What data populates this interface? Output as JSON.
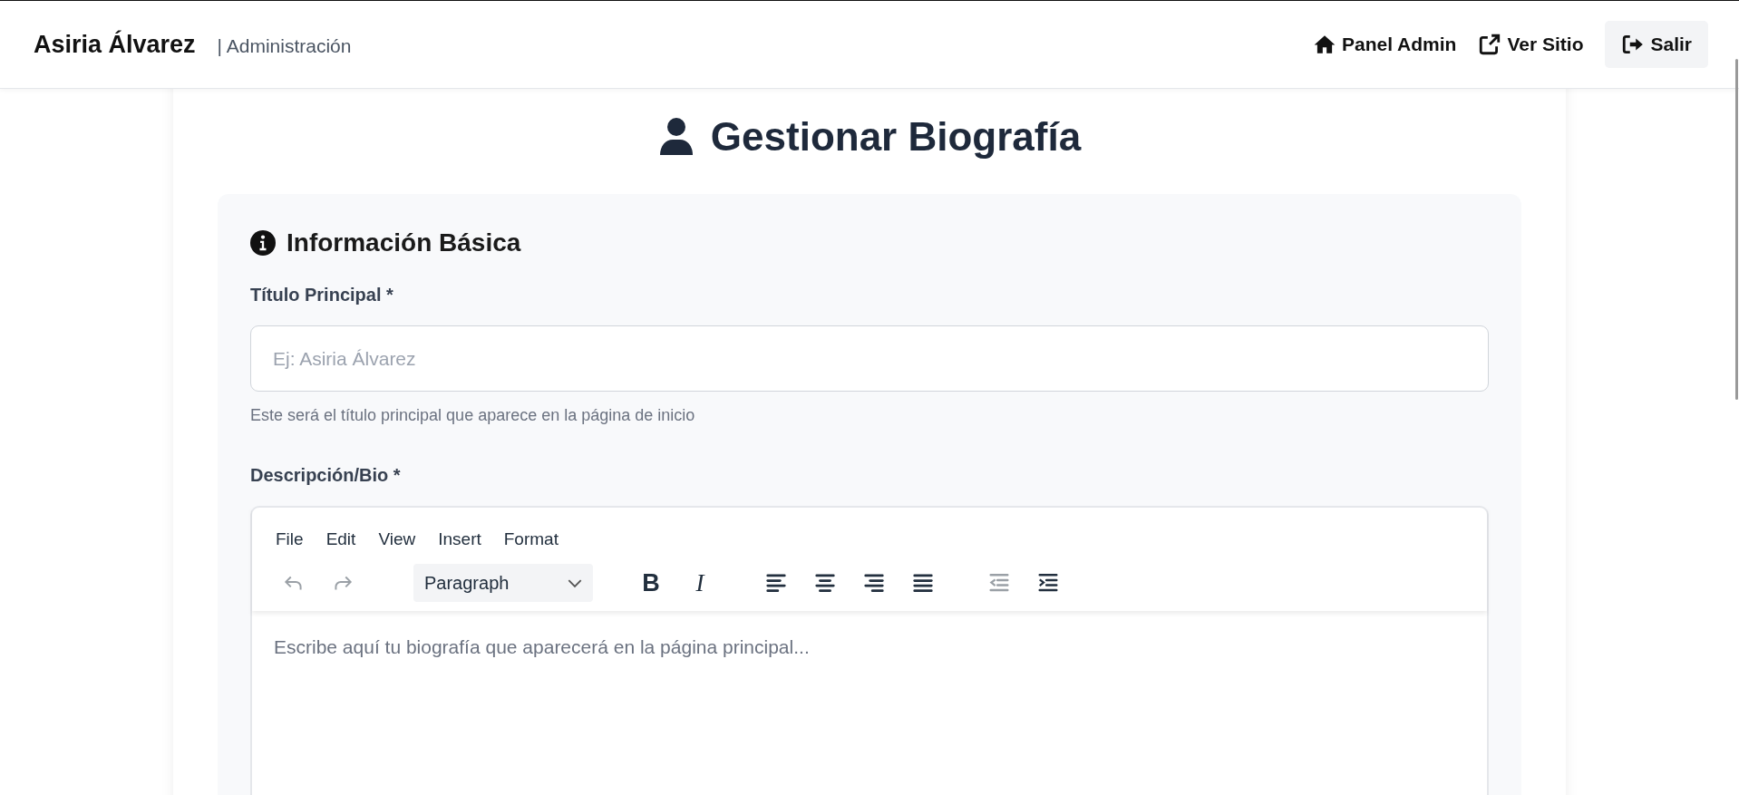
{
  "header": {
    "brand": "Asiria Álvarez",
    "subtitle": "| Administración",
    "nav": [
      {
        "kind": "home",
        "label": "Panel Admin"
      },
      {
        "kind": "external",
        "label": "Ver Sitio"
      },
      {
        "kind": "logout",
        "label": "Salir"
      }
    ]
  },
  "page_title": "Gestionar Biografía",
  "section": {
    "title": "Información Básica",
    "title_field": {
      "label": "Título Principal *",
      "placeholder": "Ej: Asiria Álvarez",
      "help": "Este será el título principal que aparece en la página de inicio"
    },
    "bio_field": {
      "label": "Descripción/Bio *",
      "menu": [
        "File",
        "Edit",
        "View",
        "Insert",
        "Format"
      ],
      "toolbar": [
        [
          {
            "kind": "undo",
            "disabled": true
          },
          {
            "kind": "redo",
            "disabled": true
          }
        ],
        [
          {
            "kind": "select",
            "label": "Paragraph",
            "disabled": false
          }
        ],
        [
          {
            "kind": "bold",
            "label": "B",
            "disabled": false
          },
          {
            "kind": "italic",
            "label": "I",
            "disabled": false
          }
        ],
        [
          {
            "kind": "align-left",
            "disabled": false
          },
          {
            "kind": "align-center",
            "disabled": false
          },
          {
            "kind": "align-right",
            "disabled": false
          },
          {
            "kind": "justify",
            "disabled": false
          }
        ],
        [
          {
            "kind": "outdent",
            "disabled": true
          },
          {
            "kind": "indent",
            "disabled": false
          }
        ]
      ],
      "placeholder": "Escribe aquí tu biografía que aparecerá en la página principal..."
    }
  }
}
